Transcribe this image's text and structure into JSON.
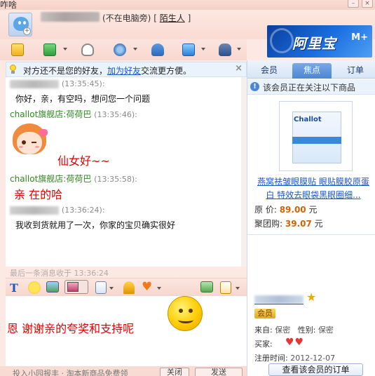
{
  "window": {
    "title": "咋啥"
  },
  "contact": {
    "status": "(不在电脑旁)",
    "relation_prefix": "[",
    "relation": "陌生人",
    "relation_suffix": "]"
  },
  "banner": {
    "logo": "阿里宝",
    "suffix": "M+"
  },
  "notice": {
    "text_before": "对方还不是您的好友，",
    "link": "加为好友",
    "text_after": "交流更方便。",
    "close": "×"
  },
  "messages": [
    {
      "sender": "",
      "time": "(13:35:45):",
      "text": "你好，亲，有空吗，想问您一个问题"
    },
    {
      "sender": "challot旗舰店:荷荷巴",
      "time": "(13:35:46):",
      "text": "仙女好~~"
    },
    {
      "sender": "challot旗舰店:荷荷巴",
      "time": "(13:35:58):",
      "text": "亲  在的哈"
    },
    {
      "sender": "",
      "time": "(13:36:24):",
      "text": "我收到货就用了一次，你家的宝贝确实很好"
    }
  ],
  "last_message": "最后一条消息收于 13:36:24",
  "input": {
    "text": "恩  谢谢亲的夸奖和支持呢"
  },
  "bottom": {
    "ad_text": "投入小园报丰 · 淘本新商品免费领",
    "close_label": "关闭",
    "send_label": "发送"
  },
  "right_panel": {
    "tabs": [
      "会员",
      "焦点",
      "订单"
    ],
    "active_tab": "焦点",
    "info": "该会员正在关注以下商品",
    "product": {
      "brand": "Challot",
      "title": "燕窝祛皱眼膜贴 眼贴膜胶原蛋白 特效去眼袋黑眼圈细...",
      "price_label": "原   价:",
      "price": "89.00",
      "group_label": "聚团购:",
      "group_price": "39.07",
      "currency": "元"
    },
    "member": {
      "vip": "会员",
      "from_label": "来自:",
      "from": "保密",
      "gender_label": "性别:",
      "gender": "保密",
      "buyer_label": "买家:",
      "buyer_level": "♥♥",
      "registered_label": "注册时间:",
      "registered": "2012-12-07",
      "orders_button": "查看该会员的订单"
    }
  },
  "colors": {
    "accent": "#1a57c9",
    "shop_name": "#2f8a1e",
    "red_text": "#e60000",
    "price": "#d46200"
  }
}
